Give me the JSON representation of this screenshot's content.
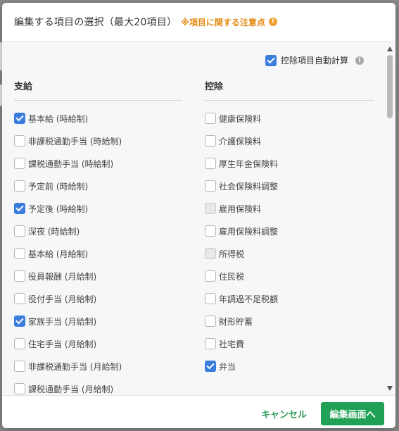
{
  "modal": {
    "title": "編集する項目の選択（最大20項目）",
    "notice": "※項目に関する注意点",
    "notice_icon": "info-circle-icon",
    "accent_color": "#21a155",
    "notice_color": "#e58a12",
    "check_color": "#3b7ddd"
  },
  "auto_calc": {
    "label": "控除項目自動計算",
    "checked": true,
    "icon": "info-circle-icon"
  },
  "pay": {
    "heading": "支給",
    "items": [
      {
        "label": "基本給 (時給制)",
        "checked": true
      },
      {
        "label": "非課税通勤手当 (時給制)",
        "checked": false
      },
      {
        "label": "課税通勤手当 (時給制)",
        "checked": false
      },
      {
        "label": "予定前 (時給制)",
        "checked": false
      },
      {
        "label": "予定後 (時給制)",
        "checked": true
      },
      {
        "label": "深夜 (時給制)",
        "checked": false
      },
      {
        "label": "基本給 (月給制)",
        "checked": false
      },
      {
        "label": "役員報酬 (月給制)",
        "checked": false
      },
      {
        "label": "役付手当 (月給制)",
        "checked": false
      },
      {
        "label": "家族手当 (月給制)",
        "checked": true
      },
      {
        "label": "住宅手当 (月給制)",
        "checked": false
      },
      {
        "label": "非課税通勤手当 (月給制)",
        "checked": false
      },
      {
        "label": "課税通勤手当 (月給制)",
        "checked": false
      }
    ]
  },
  "deduction": {
    "heading": "控除",
    "items": [
      {
        "label": "健康保険料",
        "checked": false
      },
      {
        "label": "介護保険料",
        "checked": false
      },
      {
        "label": "厚生年金保険料",
        "checked": false
      },
      {
        "label": "社会保険料調整",
        "checked": false
      },
      {
        "label": "雇用保険料",
        "checked": false,
        "disabled": true
      },
      {
        "label": "雇用保険料調整",
        "checked": false
      },
      {
        "label": "所得税",
        "checked": false,
        "disabled": true
      },
      {
        "label": "住民税",
        "checked": false
      },
      {
        "label": "年調過不足税額",
        "checked": false
      },
      {
        "label": "財形貯蓄",
        "checked": false
      },
      {
        "label": "社宅費",
        "checked": false
      },
      {
        "label": "弁当",
        "checked": true
      }
    ]
  },
  "footer": {
    "cancel_label": "キャンセル",
    "submit_label": "編集画面へ"
  }
}
